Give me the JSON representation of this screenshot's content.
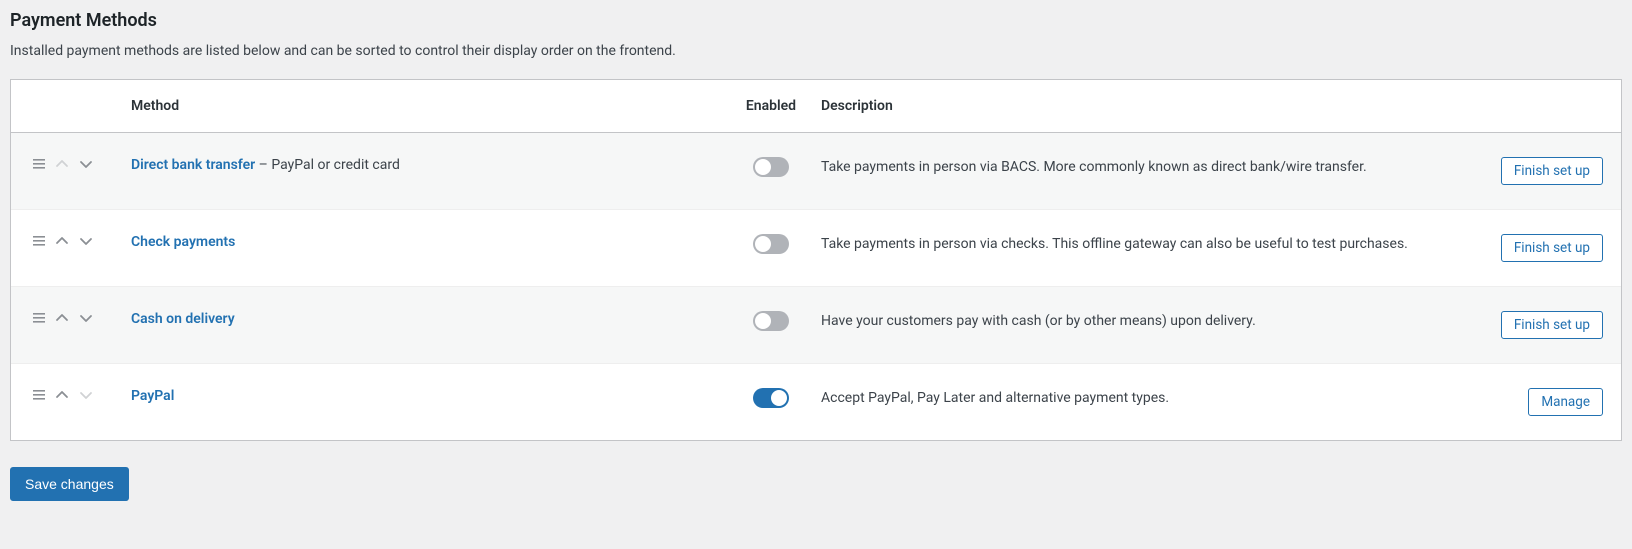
{
  "heading": "Payment Methods",
  "subtext": "Installed payment methods are listed below and can be sorted to control their display order on the frontend.",
  "columns": {
    "method": "Method",
    "enabled": "Enabled",
    "description": "Description"
  },
  "rows": [
    {
      "name": "Direct bank transfer",
      "suffix": " – PayPal or credit card",
      "enabled": false,
      "description": "Take payments in person via BACS. More commonly known as direct bank/wire transfer.",
      "action": "Finish set up",
      "up_disabled": true,
      "down_disabled": false
    },
    {
      "name": "Check payments",
      "suffix": "",
      "enabled": false,
      "description": "Take payments in person via checks. This offline gateway can also be useful to test purchases.",
      "action": "Finish set up",
      "up_disabled": false,
      "down_disabled": false
    },
    {
      "name": "Cash on delivery",
      "suffix": "",
      "enabled": false,
      "description": "Have your customers pay with cash (or by other means) upon delivery.",
      "action": "Finish set up",
      "up_disabled": false,
      "down_disabled": false
    },
    {
      "name": "PayPal",
      "suffix": "",
      "enabled": true,
      "description": "Accept PayPal, Pay Later and alternative payment types.",
      "action": "Manage",
      "up_disabled": false,
      "down_disabled": true
    }
  ],
  "save_label": "Save changes"
}
